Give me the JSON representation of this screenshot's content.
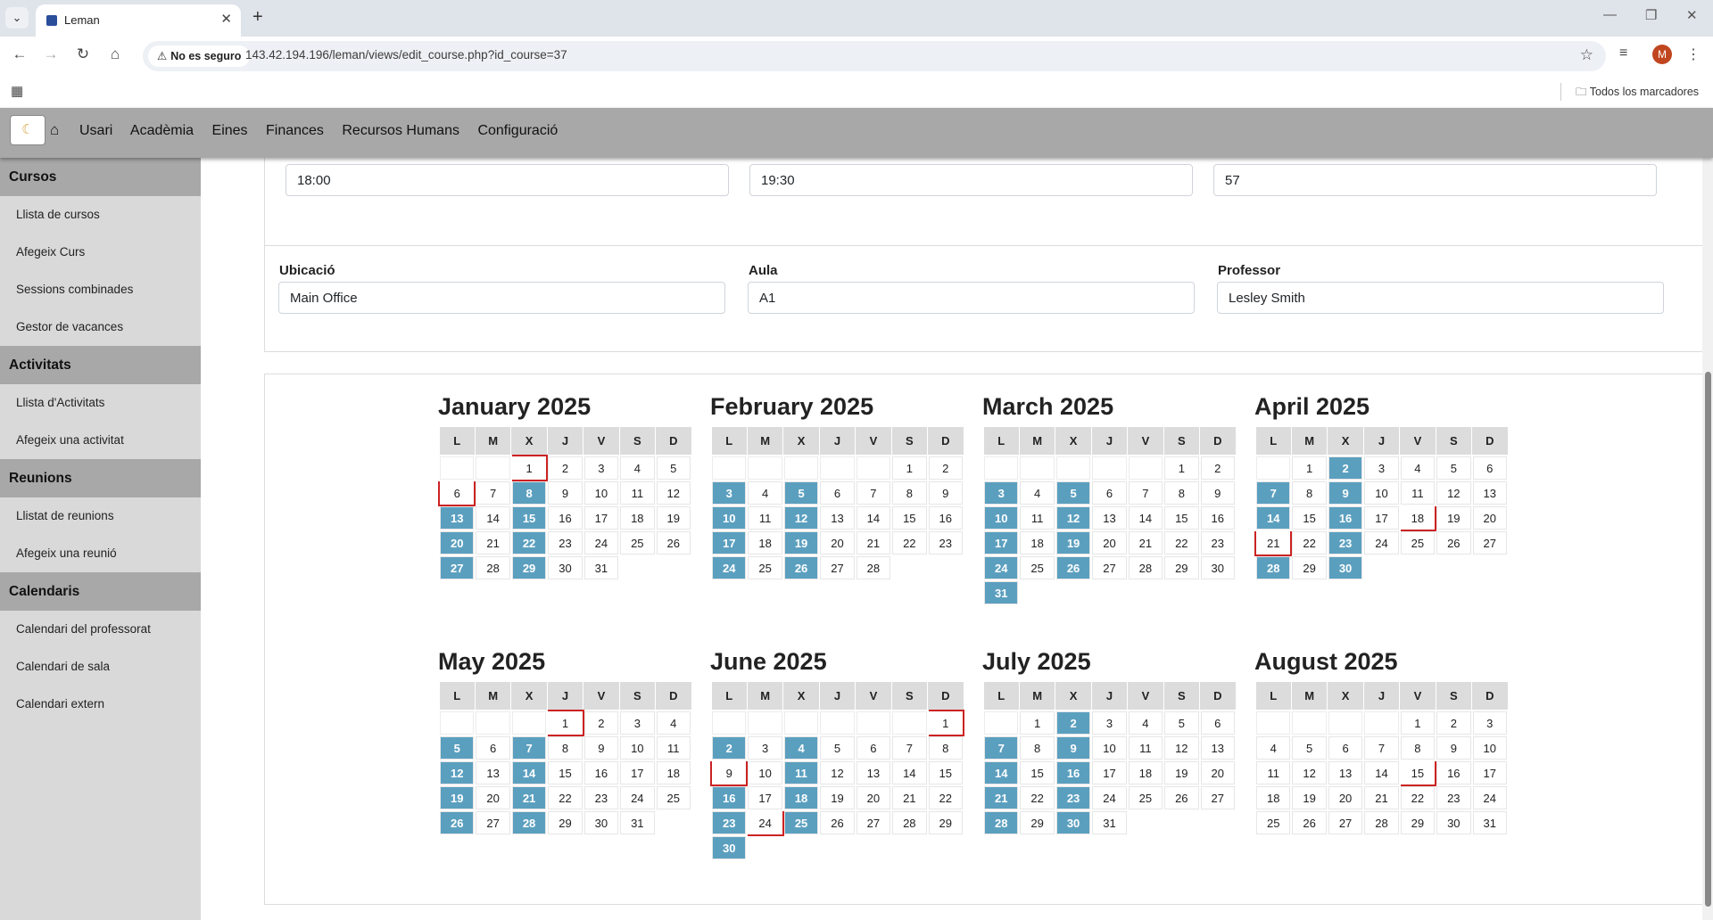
{
  "browser": {
    "tab_title": "Leman",
    "security_label": "No es seguro",
    "url": "143.42.194.196/leman/views/edit_course.php?id_course=37",
    "bookmarks_folder": "Todos los marcadores",
    "profile_initial": "M"
  },
  "navbar": {
    "menu": [
      "Usari",
      "Acadèmia",
      "Eines",
      "Finances",
      "Recursos Humans",
      "Configuració"
    ]
  },
  "sidebar": {
    "sections": [
      {
        "title": "Cursos",
        "items": [
          "Llista de cursos",
          "Afegeix Curs",
          "Sessions combinades",
          "Gestor de vacances"
        ]
      },
      {
        "title": "Activitats",
        "items": [
          "Llista d'Activitats",
          "Afegeix una activitat"
        ]
      },
      {
        "title": "Reunions",
        "items": [
          "Llistat de reunions",
          "Afegeix una reunió"
        ]
      },
      {
        "title": "Calendaris",
        "items": [
          "Calendari del professorat",
          "Calendari de sala",
          "Calendari extern"
        ]
      }
    ]
  },
  "form": {
    "start_time": "18:00",
    "end_time": "19:30",
    "duration": "57",
    "location_label": "Ubicació",
    "location_value": "Main Office",
    "room_label": "Aula",
    "room_value": "A1",
    "teacher_label": "Professor",
    "teacher_value": "Lesley Smith"
  },
  "calendar": {
    "weekdays": [
      "L",
      "M",
      "X",
      "J",
      "V",
      "S",
      "D"
    ],
    "highlight_color": "#5b9fbf",
    "mark_color": "#cc2222",
    "months": [
      {
        "title": "January 2025",
        "offset": 2,
        "days": 31,
        "highlighted": [
          8,
          13,
          15,
          20,
          22,
          27,
          29
        ],
        "marked": [
          1,
          6
        ]
      },
      {
        "title": "February 2025",
        "offset": 5,
        "days": 28,
        "highlighted": [
          3,
          5,
          10,
          12,
          17,
          19,
          24,
          26
        ],
        "marked": []
      },
      {
        "title": "March 2025",
        "offset": 5,
        "days": 31,
        "highlighted": [
          3,
          5,
          10,
          12,
          17,
          19,
          24,
          26,
          31
        ],
        "marked": []
      },
      {
        "title": "April 2025",
        "offset": 1,
        "days": 30,
        "highlighted": [
          2,
          7,
          9,
          14,
          16,
          23,
          28,
          30
        ],
        "marked": [
          18,
          21
        ]
      },
      {
        "title": "May 2025",
        "offset": 3,
        "days": 31,
        "highlighted": [
          5,
          7,
          12,
          14,
          19,
          21,
          26,
          28
        ],
        "marked": [
          1
        ]
      },
      {
        "title": "June 2025",
        "offset": 6,
        "days": 30,
        "highlighted": [
          2,
          4,
          11,
          16,
          18,
          23,
          25,
          30
        ],
        "marked": [
          1,
          9,
          24
        ]
      },
      {
        "title": "July 2025",
        "offset": 1,
        "days": 31,
        "highlighted": [
          2,
          7,
          9,
          14,
          16,
          21,
          23,
          28,
          30
        ],
        "marked": []
      },
      {
        "title": "August 2025",
        "offset": 4,
        "days": 31,
        "highlighted": [],
        "marked": [
          15
        ]
      }
    ]
  }
}
